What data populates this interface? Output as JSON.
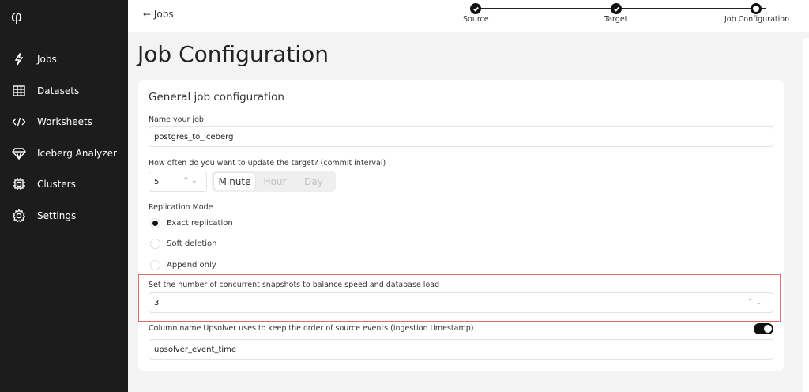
{
  "sidebar": {
    "logo": "φ",
    "items": [
      {
        "label": "Jobs",
        "icon": "bolt-icon"
      },
      {
        "label": "Datasets",
        "icon": "table-icon"
      },
      {
        "label": "Worksheets",
        "icon": "code-icon"
      },
      {
        "label": "Iceberg Analyzer",
        "icon": "gem-icon"
      },
      {
        "label": "Clusters",
        "icon": "chip-icon"
      },
      {
        "label": "Settings",
        "icon": "gear-icon"
      }
    ]
  },
  "topbar": {
    "back_label": "← Jobs",
    "steps": [
      {
        "label": "Source",
        "state": "done"
      },
      {
        "label": "Target",
        "state": "done"
      },
      {
        "label": "Job Configuration",
        "state": "current"
      }
    ]
  },
  "page": {
    "title": "Job Configuration",
    "section_title": "General job configuration",
    "name_label": "Name your job",
    "name_value": "postgres_to_iceberg",
    "interval_label": "How often do you want to update the target? (commit interval)",
    "interval_value": "5",
    "interval_units": [
      "Minute",
      "Hour",
      "Day"
    ],
    "interval_selected_unit": "Minute",
    "replication_label": "Replication Mode",
    "replication_options": [
      "Exact replication",
      "Soft deletion",
      "Append only"
    ],
    "replication_selected": "Exact replication",
    "snapshots_label": "Set the number of concurrent snapshots to balance speed and database load",
    "snapshots_value": "3",
    "column_label": "Column name Upsolver uses to keep the order of source events (ingestion timestamp)",
    "column_toggle_on": true,
    "column_value": "upsolver_event_time"
  },
  "colors": {
    "sidebar_bg": "#1c1c1c",
    "highlight_border": "#e06b6b",
    "accent": "#111111"
  }
}
